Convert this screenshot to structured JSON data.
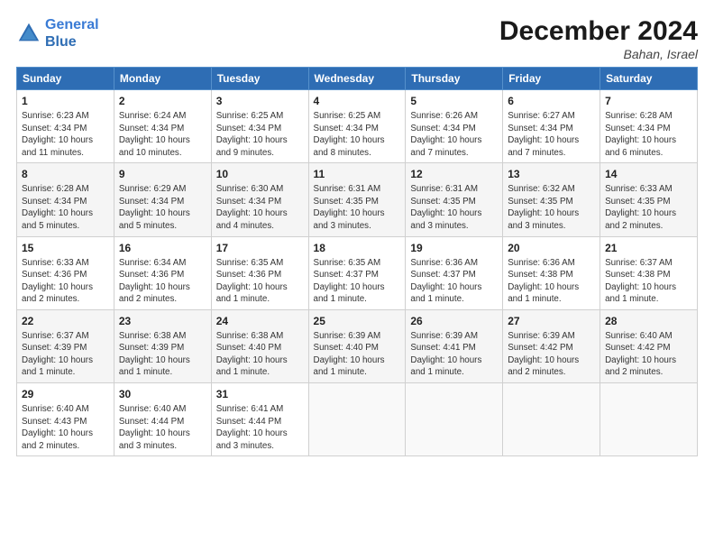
{
  "logo": {
    "line1": "General",
    "line2": "Blue"
  },
  "title": "December 2024",
  "location": "Bahan, Israel",
  "days_of_week": [
    "Sunday",
    "Monday",
    "Tuesday",
    "Wednesday",
    "Thursday",
    "Friday",
    "Saturday"
  ],
  "weeks": [
    [
      {
        "day": 1,
        "info": "Sunrise: 6:23 AM\nSunset: 4:34 PM\nDaylight: 10 hours\nand 11 minutes."
      },
      {
        "day": 2,
        "info": "Sunrise: 6:24 AM\nSunset: 4:34 PM\nDaylight: 10 hours\nand 10 minutes."
      },
      {
        "day": 3,
        "info": "Sunrise: 6:25 AM\nSunset: 4:34 PM\nDaylight: 10 hours\nand 9 minutes."
      },
      {
        "day": 4,
        "info": "Sunrise: 6:25 AM\nSunset: 4:34 PM\nDaylight: 10 hours\nand 8 minutes."
      },
      {
        "day": 5,
        "info": "Sunrise: 6:26 AM\nSunset: 4:34 PM\nDaylight: 10 hours\nand 7 minutes."
      },
      {
        "day": 6,
        "info": "Sunrise: 6:27 AM\nSunset: 4:34 PM\nDaylight: 10 hours\nand 7 minutes."
      },
      {
        "day": 7,
        "info": "Sunrise: 6:28 AM\nSunset: 4:34 PM\nDaylight: 10 hours\nand 6 minutes."
      }
    ],
    [
      {
        "day": 8,
        "info": "Sunrise: 6:28 AM\nSunset: 4:34 PM\nDaylight: 10 hours\nand 5 minutes."
      },
      {
        "day": 9,
        "info": "Sunrise: 6:29 AM\nSunset: 4:34 PM\nDaylight: 10 hours\nand 5 minutes."
      },
      {
        "day": 10,
        "info": "Sunrise: 6:30 AM\nSunset: 4:34 PM\nDaylight: 10 hours\nand 4 minutes."
      },
      {
        "day": 11,
        "info": "Sunrise: 6:31 AM\nSunset: 4:35 PM\nDaylight: 10 hours\nand 3 minutes."
      },
      {
        "day": 12,
        "info": "Sunrise: 6:31 AM\nSunset: 4:35 PM\nDaylight: 10 hours\nand 3 minutes."
      },
      {
        "day": 13,
        "info": "Sunrise: 6:32 AM\nSunset: 4:35 PM\nDaylight: 10 hours\nand 3 minutes."
      },
      {
        "day": 14,
        "info": "Sunrise: 6:33 AM\nSunset: 4:35 PM\nDaylight: 10 hours\nand 2 minutes."
      }
    ],
    [
      {
        "day": 15,
        "info": "Sunrise: 6:33 AM\nSunset: 4:36 PM\nDaylight: 10 hours\nand 2 minutes."
      },
      {
        "day": 16,
        "info": "Sunrise: 6:34 AM\nSunset: 4:36 PM\nDaylight: 10 hours\nand 2 minutes."
      },
      {
        "day": 17,
        "info": "Sunrise: 6:35 AM\nSunset: 4:36 PM\nDaylight: 10 hours\nand 1 minute."
      },
      {
        "day": 18,
        "info": "Sunrise: 6:35 AM\nSunset: 4:37 PM\nDaylight: 10 hours\nand 1 minute."
      },
      {
        "day": 19,
        "info": "Sunrise: 6:36 AM\nSunset: 4:37 PM\nDaylight: 10 hours\nand 1 minute."
      },
      {
        "day": 20,
        "info": "Sunrise: 6:36 AM\nSunset: 4:38 PM\nDaylight: 10 hours\nand 1 minute."
      },
      {
        "day": 21,
        "info": "Sunrise: 6:37 AM\nSunset: 4:38 PM\nDaylight: 10 hours\nand 1 minute."
      }
    ],
    [
      {
        "day": 22,
        "info": "Sunrise: 6:37 AM\nSunset: 4:39 PM\nDaylight: 10 hours\nand 1 minute."
      },
      {
        "day": 23,
        "info": "Sunrise: 6:38 AM\nSunset: 4:39 PM\nDaylight: 10 hours\nand 1 minute."
      },
      {
        "day": 24,
        "info": "Sunrise: 6:38 AM\nSunset: 4:40 PM\nDaylight: 10 hours\nand 1 minute."
      },
      {
        "day": 25,
        "info": "Sunrise: 6:39 AM\nSunset: 4:40 PM\nDaylight: 10 hours\nand 1 minute."
      },
      {
        "day": 26,
        "info": "Sunrise: 6:39 AM\nSunset: 4:41 PM\nDaylight: 10 hours\nand 1 minute."
      },
      {
        "day": 27,
        "info": "Sunrise: 6:39 AM\nSunset: 4:42 PM\nDaylight: 10 hours\nand 2 minutes."
      },
      {
        "day": 28,
        "info": "Sunrise: 6:40 AM\nSunset: 4:42 PM\nDaylight: 10 hours\nand 2 minutes."
      }
    ],
    [
      {
        "day": 29,
        "info": "Sunrise: 6:40 AM\nSunset: 4:43 PM\nDaylight: 10 hours\nand 2 minutes."
      },
      {
        "day": 30,
        "info": "Sunrise: 6:40 AM\nSunset: 4:44 PM\nDaylight: 10 hours\nand 3 minutes."
      },
      {
        "day": 31,
        "info": "Sunrise: 6:41 AM\nSunset: 4:44 PM\nDaylight: 10 hours\nand 3 minutes."
      },
      null,
      null,
      null,
      null
    ]
  ]
}
